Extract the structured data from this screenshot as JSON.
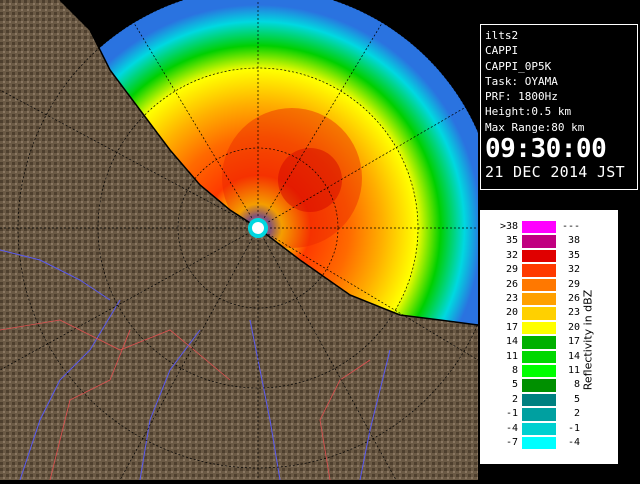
{
  "info": {
    "radar_id": "ilts2",
    "product": "CAPPI",
    "product_code": "CAPPI_0P5K",
    "task": "Task: OYAMA",
    "prf": "PRF: 1800Hz",
    "height": "Height:0.5 km",
    "max_range": "Max Range:80 km",
    "time": "09:30:00",
    "date": "21 DEC 2014 JST"
  },
  "legend": {
    "title": "Reflectivity in dBZ",
    "rows": [
      {
        "lo": ">38",
        "hi": "---",
        "color": "#ff00ff"
      },
      {
        "lo": "35",
        "hi": "38",
        "color": "#c00080"
      },
      {
        "lo": "32",
        "hi": "35",
        "color": "#e00000"
      },
      {
        "lo": "29",
        "hi": "32",
        "color": "#ff3a00"
      },
      {
        "lo": "26",
        "hi": "29",
        "color": "#ff7800"
      },
      {
        "lo": "23",
        "hi": "26",
        "color": "#ffa000"
      },
      {
        "lo": "20",
        "hi": "23",
        "color": "#ffd000"
      },
      {
        "lo": "17",
        "hi": "20",
        "color": "#ffff00"
      },
      {
        "lo": "14",
        "hi": "17",
        "color": "#00b000"
      },
      {
        "lo": "11",
        "hi": "14",
        "color": "#00d800"
      },
      {
        "lo": "8",
        "hi": "11",
        "color": "#00ff00"
      },
      {
        "lo": "5",
        "hi": "8",
        "color": "#009000"
      },
      {
        "lo": "2",
        "hi": "5",
        "color": "#008080"
      },
      {
        "lo": "-1",
        "hi": "2",
        "color": "#00a0a0"
      },
      {
        "lo": "-4",
        "hi": "-1",
        "color": "#00d0d0"
      },
      {
        "lo": "-7",
        "hi": "-4",
        "color": "#00ffff"
      }
    ]
  },
  "map": {
    "land_color": "#6b5a45",
    "sea_color": "#2a73e0",
    "echo_core_color": "#ff3a00",
    "echo_colors": [
      "#2a73e0",
      "#00d8e0",
      "#00c800",
      "#ffff00",
      "#ffb000",
      "#ff5a00"
    ]
  }
}
